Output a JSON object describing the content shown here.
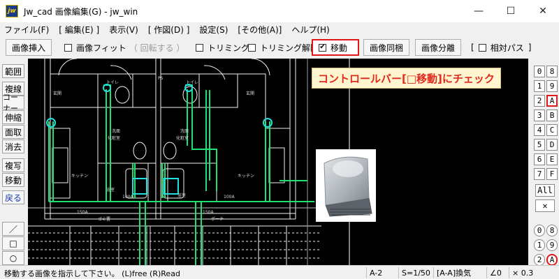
{
  "window": {
    "icon_text": "jw",
    "title": "Jw_cad 画像編集(G) - jw_win",
    "minimize": "—",
    "maximize": "☐",
    "close": "✕"
  },
  "menu": [
    "ファイル(F)",
    "[ 編集(E) ]",
    "表示(V)",
    "[ 作図(D) ]",
    "設定(S)",
    "[その他(A)]",
    "ヘルプ(H)"
  ],
  "toolbar": {
    "insert_image": "画像挿入",
    "image_fit": "画像フィット",
    "rotate": "（ 回転する ）",
    "trimming": "トリミング",
    "trimming_cancel": "トリミング解除",
    "move": "移動",
    "move_checked": "✔",
    "bundle": "画像同梱",
    "separate": "画像分離",
    "relative_path": "相対パス",
    "relative_open": "[",
    "relative_close": "]"
  },
  "left_tools": [
    "範囲",
    "複線",
    "コーナー",
    "伸縮",
    "面取",
    "消去",
    "複写",
    "移動",
    "戻る"
  ],
  "left_shapes": {
    "line": "／",
    "rect": "□",
    "circle": "○"
  },
  "right_layers_top": [
    [
      "0",
      "8"
    ],
    [
      "1",
      "9"
    ],
    [
      "2",
      "A"
    ],
    [
      "3",
      "B"
    ],
    [
      "4",
      "C"
    ],
    [
      "5",
      "D"
    ],
    [
      "6",
      "E"
    ],
    [
      "7",
      "F"
    ]
  ],
  "right_all": "All",
  "right_x": "✕",
  "right_groups": [
    [
      "0",
      "8"
    ],
    [
      "1",
      "9"
    ],
    [
      "2",
      "A"
    ]
  ],
  "callout": "コントロールバー[□移動]にチェック",
  "status": {
    "message": "移動する画像を指示して下さい。 (L)free (R)Read",
    "paper": "A-2",
    "scale": "S=1/50",
    "layer": "[A-A]換気",
    "angle": "∠0",
    "mult": "× 0.3"
  },
  "drawing": {
    "labels": [
      "玄関",
      "トイレ",
      "PS",
      "トイレ",
      "玄関",
      "洗面",
      "化粧室",
      "洗面",
      "化粧室",
      "キッチン",
      "浴室",
      "浴室",
      "キッチン",
      "150A",
      "150A",
      "100A",
      "100A",
      "ゴミ置",
      "ポーチ"
    ]
  },
  "colors": {
    "canvas": "#000000",
    "duct": "#20e070",
    "fan": "#20e0e0",
    "callout_text": "#e0281e",
    "highlight_border": "#e01818"
  }
}
